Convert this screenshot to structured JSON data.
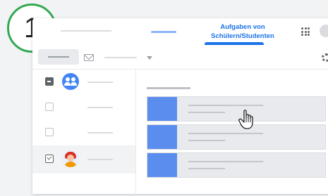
{
  "step_badge": {
    "number": "1",
    "accent_color": "#34a853"
  },
  "header": {
    "active_tab_label": "Aufgaben von Schülern/Studenten",
    "accent_color": "#1a73e8"
  },
  "icons": {
    "apps": "apps-grid-icon",
    "profile": "profile-icon",
    "mail": "mail-icon",
    "dropdown": "chevron-down-icon",
    "settings": "gear-icon",
    "cursor": "hand-pointer-icon"
  },
  "sidebar": {
    "rows": [
      {
        "type": "group",
        "checkbox": "indeterminate"
      },
      {
        "type": "student",
        "checkbox": "unchecked"
      },
      {
        "type": "student",
        "checkbox": "unchecked"
      },
      {
        "type": "student",
        "checkbox": "checked",
        "selected": true
      }
    ]
  },
  "main": {
    "cards": [
      {
        "color": "#5b8def"
      },
      {
        "color": "#5b8def"
      },
      {
        "color": "#5b8def"
      }
    ]
  }
}
